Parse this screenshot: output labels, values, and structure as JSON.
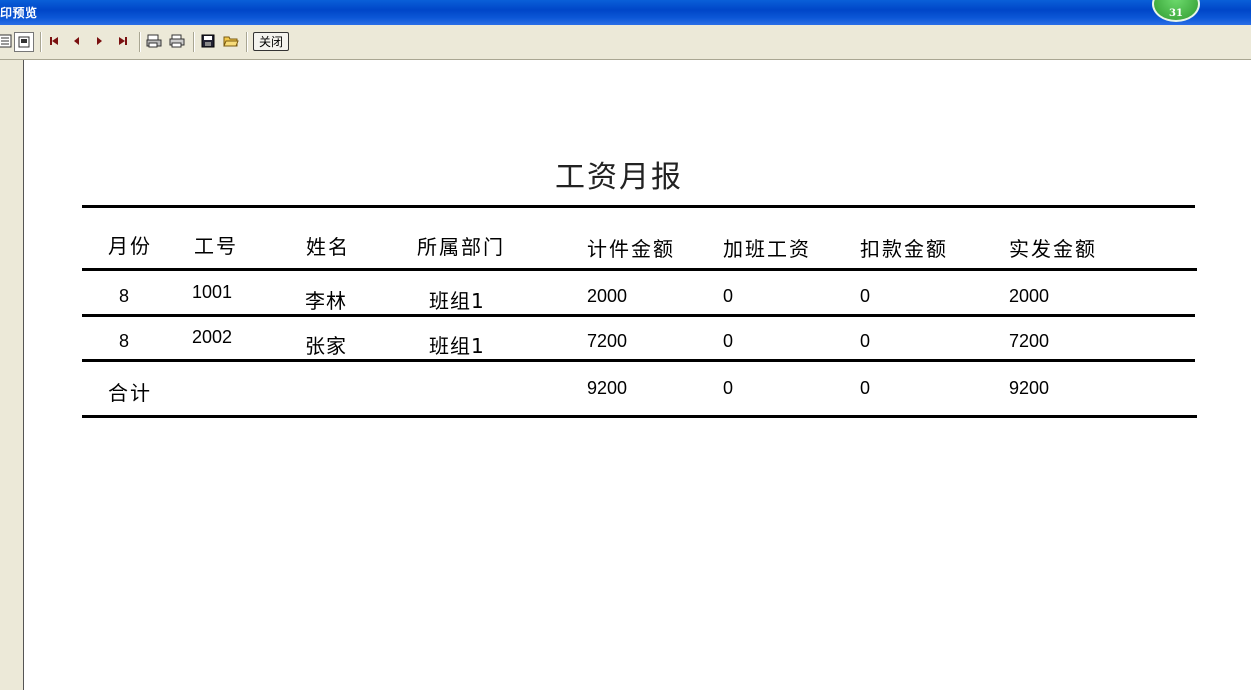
{
  "window": {
    "title": "印预览",
    "badge": "31"
  },
  "toolbar": {
    "close_label": "关闭"
  },
  "report": {
    "title": "工资月报",
    "columns": [
      "月份",
      "工号",
      "姓名",
      "所属部门",
      "计件金额",
      "加班工资",
      "扣款金额",
      "实发金额"
    ],
    "rows": [
      {
        "month": "8",
        "id": "1001",
        "name": "李林",
        "dept": "班组1",
        "piece": "2000",
        "overtime": "0",
        "deduct": "0",
        "net": "2000"
      },
      {
        "month": "8",
        "id": "2002",
        "name": "张家",
        "dept": "班组1",
        "piece": "7200",
        "overtime": "0",
        "deduct": "0",
        "net": "7200"
      }
    ],
    "total": {
      "label": "合计",
      "piece": "9200",
      "overtime": "0",
      "deduct": "0",
      "net": "9200"
    }
  }
}
